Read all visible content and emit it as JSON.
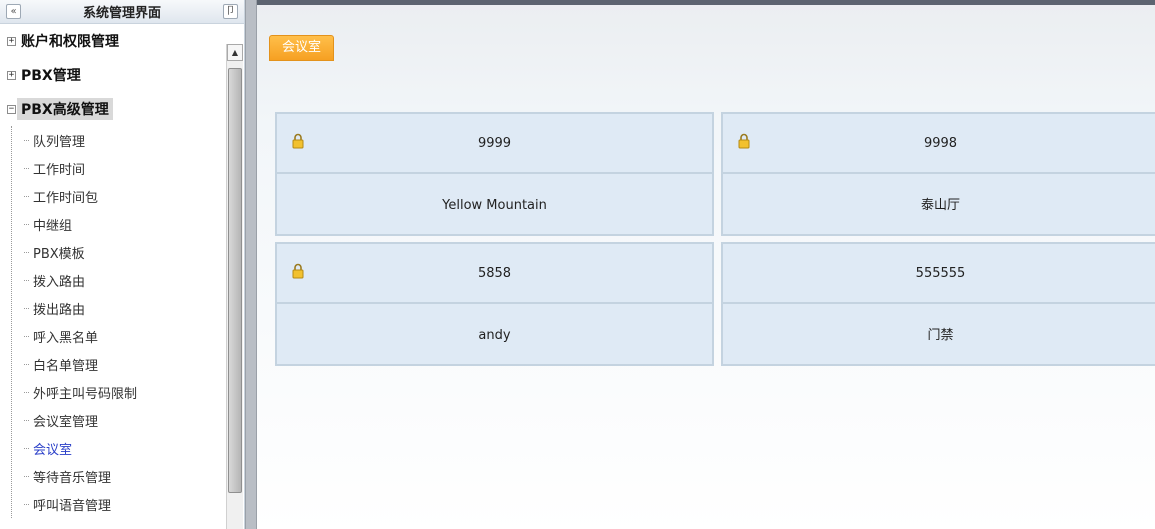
{
  "sidebar": {
    "title": "系统管理界面",
    "collapse_glyph": "«",
    "pin_glyph": "卩",
    "nodes": [
      {
        "label": "账户和权限管理",
        "toggle": "+"
      },
      {
        "label": "PBX管理",
        "toggle": "+"
      },
      {
        "label": "PBX高级管理",
        "toggle": "−"
      }
    ],
    "children": [
      "队列管理",
      "工作时间",
      "工作时间包",
      "中继组",
      "PBX模板",
      "拨入路由",
      "拨出路由",
      "呼入黑名单",
      "白名单管理",
      "外呼主叫号码限制",
      "会议室管理",
      "会议室",
      "等待音乐管理",
      "呼叫语音管理"
    ],
    "active_child": "会议室",
    "scroll_up_glyph": "▲"
  },
  "main": {
    "tab_label": "会议室",
    "rooms": [
      {
        "number": "9999",
        "name": "Yellow Mountain",
        "locked": true
      },
      {
        "number": "9998",
        "name": "泰山厅",
        "locked": true
      },
      {
        "number": "5858",
        "name": "andy",
        "locked": true
      },
      {
        "number": "555555",
        "name": "门禁",
        "locked": false
      }
    ]
  },
  "colors": {
    "tab_orange": "#f6a022",
    "active_link": "#2a3fc8",
    "card_fill": "#dfeaf5",
    "card_border": "#c4d3e0"
  },
  "icons": {
    "lock": "lock-icon",
    "collapse": "double-chevron-left-icon",
    "pin": "pin-icon"
  }
}
